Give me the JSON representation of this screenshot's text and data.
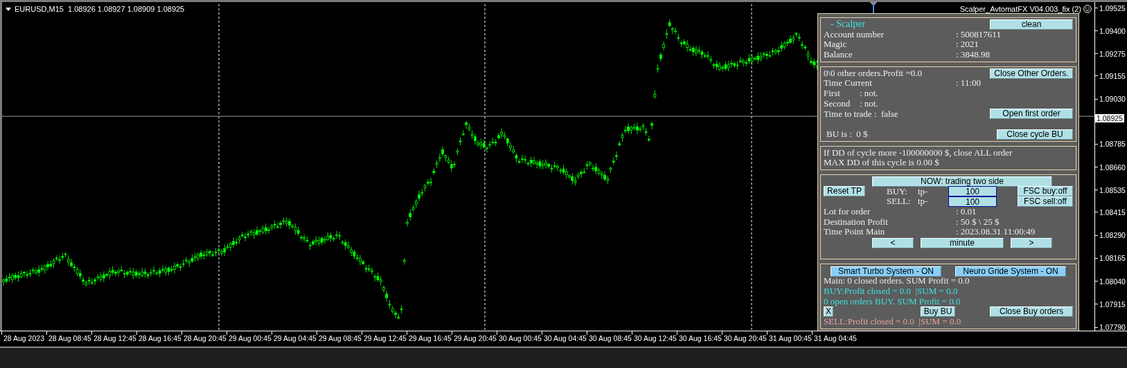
{
  "chart": {
    "symbol_header": "EURUSD,M15  1.08926 1.08927 1.08909 1.08925",
    "indicator_title": "Scalper_AvtomatFX V04.003_fix (2)"
  },
  "price_axis": {
    "labels": [
      "1.09525",
      "1.09400",
      "1.09275",
      "1.09155",
      "1.09030",
      "1.08785",
      "1.08660",
      "1.08535",
      "1.08415",
      "1.08290",
      "1.08165",
      "1.08040",
      "1.07915",
      "1.07790"
    ],
    "current_price": "1.08925"
  },
  "time_axis": {
    "labels": [
      "28 Aug 2023",
      "28 Aug 08:45",
      "28 Aug 12:45",
      "28 Aug 16:45",
      "28 Aug 20:45",
      "29 Aug 00:45",
      "29 Aug 04:45",
      "29 Aug 08:45",
      "29 Aug 12:45",
      "29 Aug 16:45",
      "29 Aug 20:45",
      "30 Aug 00:45",
      "30 Aug 04:45",
      "30 Aug 08:45",
      "30 Aug 12:45",
      "30 Aug 16:45",
      "30 Aug 20:45",
      "31 Aug 00:45",
      "31 Aug 04:45"
    ]
  },
  "panel": {
    "account": {
      "title": "- Scalper",
      "clean_button": "clean",
      "rows": [
        {
          "label": "Account number",
          "value": ": 500817611"
        },
        {
          "label": "Magic",
          "value": ": 2021"
        },
        {
          "label": "Balance",
          "value": ": 3848.98"
        }
      ]
    },
    "orders": {
      "summary": "0\\0 other orders.Profit =0.0",
      "close_other_button": "Close Other Orders.",
      "time_current": {
        "label": "Time Current",
        "value": ": 11:00"
      },
      "first": {
        "label": "First",
        "value": ": not."
      },
      "second": {
        "label": "Second",
        "value": ": not."
      },
      "time_to_trade": "Time to trade :  false",
      "open_first_button": "Open first order",
      "bu": "BU is :  0 $",
      "close_cycle_button": "Close cycle BU"
    },
    "drawdown": {
      "lines": [
        "If DD of cycle more -100000000 $, close ALL order",
        "MAX DD of this cycle is 0.00 $"
      ]
    },
    "trading": {
      "mode_button": "NOW: trading two side",
      "reset_button": "Reset TP",
      "buy": {
        "label": "BUY:",
        "tp": "tp-",
        "value": "100",
        "fsc_button": "FSC buy:off"
      },
      "sell": {
        "label": "SELL:",
        "tp": "tp-",
        "value": "100",
        "fsc_button": "FSC sell:off"
      },
      "rows": [
        {
          "label": "Lot for order",
          "value": ": 0.01"
        },
        {
          "label": "Destination Profit",
          "value": ": 50 $ \\ 25 $"
        },
        {
          "label": "Time Point Main",
          "value": ": 2023.08.31 11:00:49"
        }
      ],
      "prev_button": "<",
      "period_button": "minute",
      "next_button": ">"
    },
    "systems": {
      "smart_turbo_button": "Smart Turbo System - ON",
      "neuro_grid_button": "Neuro Gride System - ON",
      "lines": [
        {
          "text": "Main: 0 closed orders. SUM Profit = 0.0",
          "color": "#e8e8e8"
        },
        {
          "text": "BUY:Profit closed = 0.0  |SUM = 0.0",
          "color": "#3fe0e0"
        },
        {
          "text": "0 open orders BUY. SUM Profit = 0.0",
          "color": "#3fe0e0"
        }
      ],
      "x_button": "X",
      "buy_bu_button": "Buy BU",
      "close_buy_button": "Close Buy orders",
      "sell_line": {
        "text": "SELL:Profit closed = 0.0  |SUM = 0.0",
        "color": "#e8a0a0"
      }
    }
  }
}
